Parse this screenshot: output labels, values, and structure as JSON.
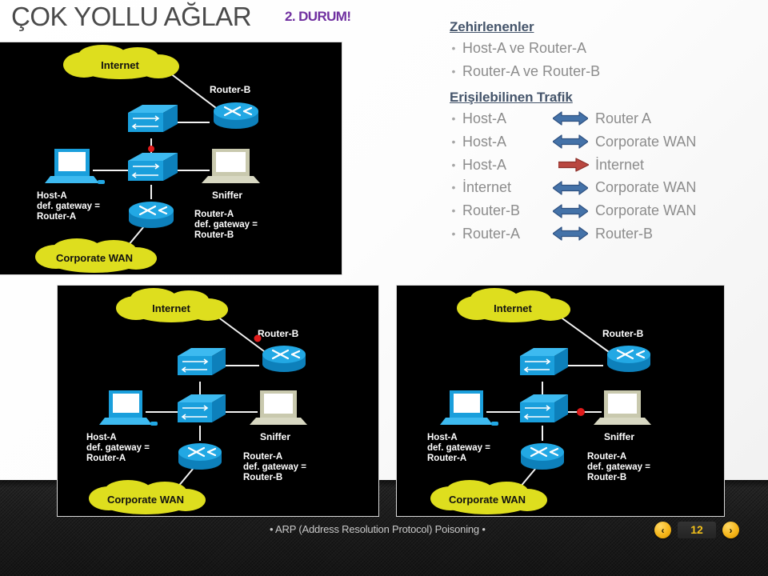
{
  "slide": {
    "title": "ÇOK YOLLU AĞLAR",
    "subtitle": "2. DURUM!",
    "title_color": "#4a4a4a",
    "subtitle_color": "#7030a0"
  },
  "poisoned": {
    "heading": "Zehirlenenler",
    "items": [
      "Host-A ve Router-A",
      "Router-A ve Router-B"
    ]
  },
  "traffic": {
    "heading": "Erişilebilinen Trafik",
    "arrow_colors": {
      "bidirectional": "#4472a8",
      "bidirectional_stroke": "#2f5181",
      "unidirectional": "#b94740",
      "unidirectional_stroke": "#8c3029"
    },
    "rows": [
      {
        "left": "Host-A",
        "arrow": "bidirectional-arrow-icon",
        "right": "Router A"
      },
      {
        "left": "Host-A",
        "arrow": "bidirectional-arrow-icon",
        "right": "Corporate WAN"
      },
      {
        "left": "Host-A",
        "arrow": "right-arrow-icon",
        "right": "İnternet"
      },
      {
        "left": "İnternet",
        "arrow": "bidirectional-arrow-icon",
        "right": "Corporate WAN"
      },
      {
        "left": "Router-B",
        "arrow": "bidirectional-arrow-icon",
        "right": "Corporate WAN"
      },
      {
        "left": "Router-A",
        "arrow": "bidirectional-arrow-icon",
        "right": "Router-B"
      }
    ]
  },
  "diagrams": {
    "labels": {
      "internet": "Internet",
      "router_b": "Router-B",
      "sniffer": "Sniffer",
      "corporate_wan": "Corporate WAN",
      "host_a_line1": "Host-A",
      "host_a_line2": "def. gateway =",
      "host_a_line3": "Router-A",
      "router_a_line1": "Router-A",
      "router_a_line2": "def. gateway =",
      "router_a_line3": "Router-B"
    },
    "colors": {
      "background": "#000000",
      "cloud": "#dede1e",
      "device_blue": "#22a0dd",
      "device_blue_dark": "#0b7bb5",
      "sniffer_beige": "#cfcfb8",
      "marker_red": "#e01b1b",
      "link": "#ffffff",
      "text": "#ffffff"
    },
    "panels": [
      {
        "name": "top-left-diagram",
        "marker": "switch-uplink"
      },
      {
        "name": "bottom-left-diagram",
        "marker": "router-b-link"
      },
      {
        "name": "bottom-right-diagram",
        "marker": "sniffer-link"
      }
    ]
  },
  "footer": {
    "text": "• ARP (Address Resolution Protocol) Poisoning •",
    "prev_label": "‹",
    "next_label": "›",
    "page_number": "12",
    "accent_color": "#f3c11a"
  }
}
